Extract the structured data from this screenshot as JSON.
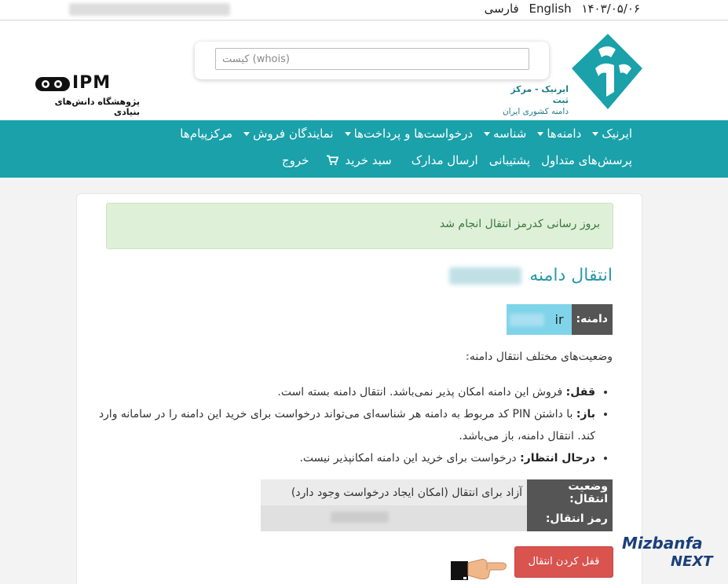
{
  "topbar": {
    "lang_fa": "فارسی",
    "lang_en": "English",
    "date": "۱۴۰۳/۰۵/۰۶"
  },
  "header": {
    "search_placeholder": "(whois) کیست",
    "irnic_line1_name": "ایرنیک",
    "irnic_line1_rest": " - مرکز ثبت",
    "irnic_line2": "دامنه کشوری ایران",
    "ipm_word": "IPM",
    "ipm_caption": "پژوهشگاه دانش‌های بنیادی"
  },
  "nav": {
    "row1": [
      {
        "label": "ایرنیک",
        "dropdown": true
      },
      {
        "label": "دامنه‌ها",
        "dropdown": true
      },
      {
        "label": "شناسه",
        "dropdown": true
      },
      {
        "label": "درخواست‌ها و پرداخت‌ها",
        "dropdown": true
      },
      {
        "label": "نمایندگان فروش",
        "dropdown": true
      },
      {
        "label": "مرکزپیام‌ها",
        "dropdown": false
      }
    ],
    "row2": [
      {
        "label": "پرسش‌های متداول"
      },
      {
        "label": "پشتیبانی"
      },
      {
        "label": "ارسال مدارک"
      },
      {
        "label": "سبد خرید",
        "icon": "cart-icon"
      },
      {
        "label": "خروج"
      }
    ]
  },
  "main": {
    "alert": "بروز رسانی کدرمز انتقال انجام شد",
    "title": "انتقال دامنه",
    "domain_label": "دامنه:",
    "domain_suffix": "ir",
    "states_heading": "وضعیت‌های مختلف انتقال دامنه",
    "states_heading_colon": ":",
    "states": [
      {
        "term": "قفل:",
        "text": " فروش این دامنه امکان پذیر نمی‌باشد. انتقال دامنه بسته است."
      },
      {
        "term": "باز:",
        "text": " با داشتن PIN کد مربوط به دامنه هر شناسه‌ای می‌تواند درخواست برای خرید این دامنه را در سامانه وارد کند. انتقال دامنه، باز می‌باشد."
      },
      {
        "term": "درحال انتظار:",
        "text": " درخواست برای خرید این دامنه امکانپذیر نیست."
      }
    ],
    "status_label": "وضعیت انتقال:",
    "status_value": "آزاد برای انتقال (امکان ایجاد درخواست وجود دارد)",
    "password_label": "رمز انتقال:",
    "lock_button": "قفل کردن انتقال"
  },
  "watermark": {
    "brand": "Mizbanfa",
    "sub": "NEXT"
  },
  "colors": {
    "nav_bg": "#1aa1aa",
    "alert_bg": "#def0d8",
    "alert_text": "#3c763d",
    "title": "#2a9aa5",
    "danger": "#d9534f",
    "label_bg": "#555555",
    "domain_value_bg": "#7fd4ea"
  }
}
